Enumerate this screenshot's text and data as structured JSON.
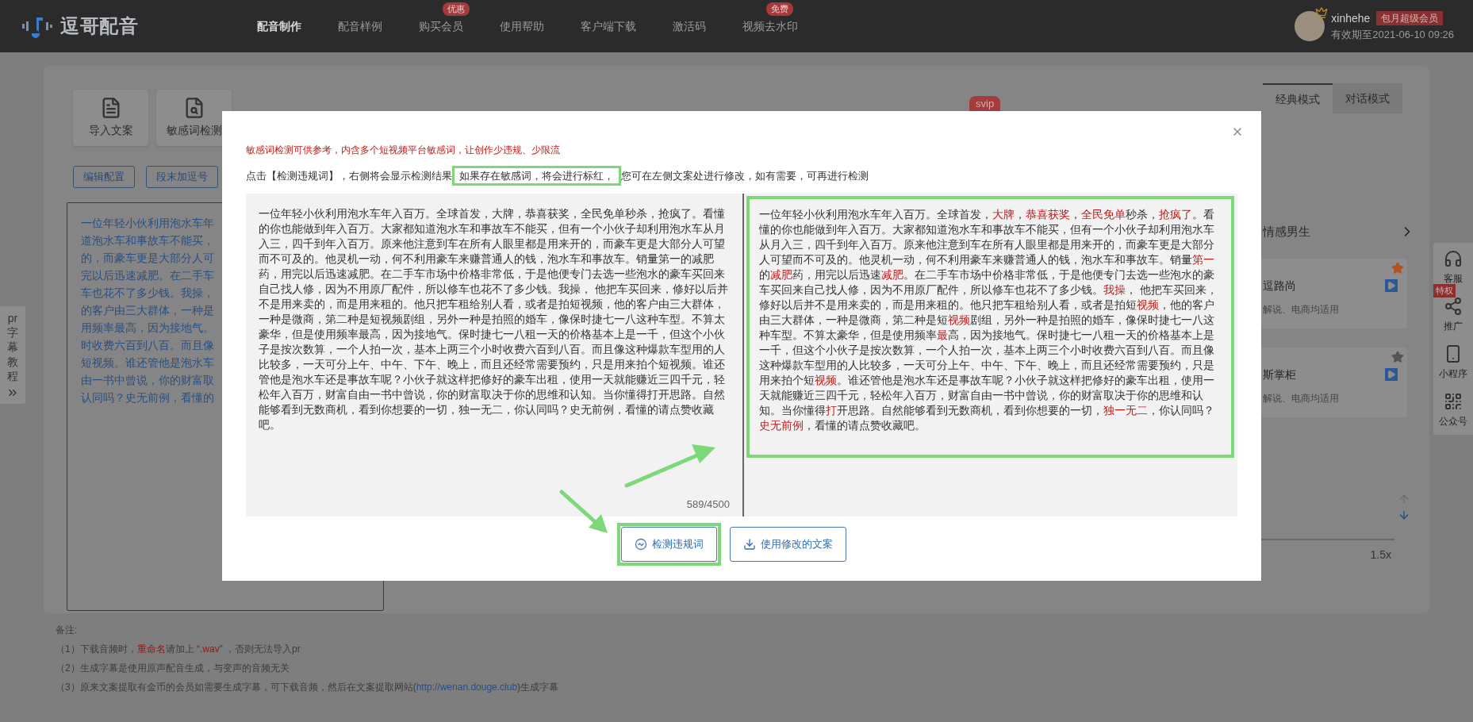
{
  "header": {
    "logo": "逗哥配音",
    "nav": [
      {
        "label": "配音制作",
        "selected": true
      },
      {
        "label": "配音样例",
        "selected": false
      },
      {
        "label": "购买会员",
        "selected": false,
        "badge": "优惠"
      },
      {
        "label": "使用帮助",
        "selected": false
      },
      {
        "label": "客户端下载",
        "selected": false
      },
      {
        "label": "激活码",
        "selected": false
      },
      {
        "label": "视频去水印",
        "selected": false,
        "badge": "免费"
      }
    ],
    "user": {
      "name": "xinhehe",
      "badge": "包月超级会员",
      "expiry": "有效期至2021-06-10 09:26"
    }
  },
  "toolbar": [
    {
      "label": "导入文案",
      "kind": "import"
    },
    {
      "label": "敏感词检测",
      "kind": "check"
    }
  ],
  "toolbar_badge": "svip",
  "mode_tabs": [
    {
      "label": "经典模式",
      "selected": true
    },
    {
      "label": "对话模式",
      "selected": false
    }
  ],
  "edit_buttons": [
    "编辑配置",
    "段末加逗号"
  ],
  "editor_lines": [
    "一位年轻小伙利用泡水车年",
    "道泡水车和事故车不能买，",
    "的，而豪车更是大部分人可",
    "完以后迅速减肥。在二手车",
    "车也花不了多少钱。我操，",
    "的客户由三大群体，一种是",
    "用频率最高，因为接地气。",
    "时收费六百到八百。而且像",
    "短视频。谁还管他是泡水车",
    "由一书中曾说，你的财富取",
    "认同吗？史无前例，看懂的"
  ],
  "side_tab": {
    "label": "pr字幕教程"
  },
  "voice_panel": {
    "category": "情感男生",
    "voices": [
      {
        "name": "逗路尚",
        "tags": "解说、电商均适用",
        "favorite": true
      },
      {
        "name": "斯掌柜",
        "tags": "解说、电商均适用",
        "favorite": false
      }
    ],
    "speed_label": "1.5x"
  },
  "float_bar": [
    {
      "label": "客服",
      "kind": "service"
    },
    {
      "label": "推广",
      "kind": "share",
      "badge": "特权"
    },
    {
      "label": "小程序",
      "kind": "mini"
    },
    {
      "label": "公众号",
      "kind": "qr"
    }
  ],
  "notes": {
    "title": "备注:",
    "items": [
      [
        {
          "text": "（1）下载音频时，",
          "kind": "plain"
        },
        {
          "text": "重命名",
          "kind": "red"
        },
        {
          "text": "请加上 ",
          "kind": "plain"
        },
        {
          "text": "“.wav”",
          "kind": "red"
        },
        {
          "text": " ，否则无法导入pr",
          "kind": "plain"
        }
      ],
      [
        {
          "text": "（2）生成字幕是使用原声配音生成，与变声的音频无关",
          "kind": "plain"
        }
      ],
      [
        {
          "text": "（3）原来文案提取有金币的会员如需要生成字幕，可下载音频，然后在文案提取网站(",
          "kind": "plain"
        },
        {
          "text": "http://wenan.douge.club",
          "kind": "link"
        },
        {
          "text": ")生成字幕",
          "kind": "plain"
        }
      ]
    ]
  },
  "dialog": {
    "warning": "敏感词检测可供参考，内含多个短视频平台敏感词，让创作少违规、少限流",
    "instruction": [
      {
        "text": "点击【检测违规词】，右侧将会显示检测结果",
        "highlighted": false
      },
      {
        "text": "如果存在敏感词，将会进行标红，",
        "highlighted": true
      },
      {
        "text": "您可在左侧文案处进行修改，如有需要，可再进行检测",
        "highlighted": false
      }
    ],
    "source_text": "一位年轻小伙利用泡水车年入百万。全球首发，大牌，恭喜获奖，全民免单秒杀，抢疯了。看懂的你也能做到年入百万。大家都知道泡水车和事故车不能买，但有一个小伙子却利用泡水车从月入三，四千到年入百万。原来他注意到车在所有人眼里都是用来开的，而豪车更是大部分人可望而不可及的。他灵机一动，何不利用豪车来赚普通人的钱，泡水车和事故车。销量第一的减肥药，用完以后迅速减肥。在二手车市场中价格非常低，于是他便专门去选一些泡水的豪车买回来自己找人修，因为不用原厂配件，所以修车也花不了多少钱。我操， 他把车买回来，修好以后并不是用来卖的，而是用来租的。他只把车租给别人看，或者是拍短视频，他的客户由三大群体，一种是微商，第二种是短视频剧组，另外一种是拍照的婚车，像保时捷七一八这种车型。不算太豪华，但是使用频率最高，因为接地气。保时捷七一八租一天的价格基本上是一千，但这个小伙子是按次数算，一个人拍一次，基本上两三个小时收费六百到八百。而且像这种爆款车型用的人比较多，一天可分上午、中午、下午、晚上，而且还经常需要预约，只是用来拍个短视频。谁还管他是泡水车还是事故车呢？小伙子就这样把修好的豪车出租，使用一天就能赚近三四千元，轻松年入百万，财富自由一书中曾说，你的财富取决于你的思维和认知。当你懂得打开思路。自然能够看到无数商机，看到你想要的一切，独一无二，你认同吗？史无前例，看懂的请点赞收藏吧。",
    "counter": "589/4500",
    "result_highlighted": true,
    "result": [
      {
        "text": "一位年轻小伙利用泡水车年入百万。全球首发，",
        "flagged": false
      },
      {
        "text": "大牌",
        "flagged": true
      },
      {
        "text": "，",
        "flagged": false
      },
      {
        "text": "恭喜获奖",
        "flagged": true
      },
      {
        "text": "，",
        "flagged": false
      },
      {
        "text": "全民免单",
        "flagged": true
      },
      {
        "text": "秒杀，",
        "flagged": false
      },
      {
        "text": "抢疯了",
        "flagged": true
      },
      {
        "text": "。看懂的你也能做到年入百万。大家都知道泡水车和事故车不能买，但有一个小伙子却利用泡水车从月入三，四千到年入百万。原来他注意到车在所有人眼里都是用来开的，而豪车更是大部分人可望而不可及的。他灵机一动，何不利用豪车来赚普通人的钱，泡水车和事故车。销量",
        "flagged": false
      },
      {
        "text": "第一",
        "flagged": true
      },
      {
        "text": "的",
        "flagged": false
      },
      {
        "text": "减肥",
        "flagged": true
      },
      {
        "text": "药，用完以后迅速",
        "flagged": false
      },
      {
        "text": "减肥",
        "flagged": true
      },
      {
        "text": "。在二手车市场中价格非常低，于是他便专门去选一些泡水的豪车买回来自己找人修，因为不用原厂配件，所以修车也花不了多少钱。",
        "flagged": false
      },
      {
        "text": "我操",
        "flagged": true
      },
      {
        "text": "， 他把车买回来，修好以后并不是用来卖的，而是用来租的。他只把车租给别人看，或者是拍短",
        "flagged": false
      },
      {
        "text": "视频",
        "flagged": true
      },
      {
        "text": "，他的客户由三大群体，一种是微商，第二种是短",
        "flagged": false
      },
      {
        "text": "视频",
        "flagged": true
      },
      {
        "text": "剧组，另外一种是拍照的婚车，像保时捷七一八这种车型。不算太豪华，但是使用频率",
        "flagged": false
      },
      {
        "text": "最",
        "flagged": true
      },
      {
        "text": "高，因为接地气。保时捷七一八租一天的价格基本上是一千，但这个小伙子是按次数算，一个人拍一次，基本上两三个小时收费六百到八百。而且像这种爆款车型用的人比较多，一天可分上午、中午、下午、晚上，而且还经常需要预约，只是用来拍个短",
        "flagged": false
      },
      {
        "text": "视频",
        "flagged": true
      },
      {
        "text": "。谁还管他是泡水车还是事故车呢？小伙子就这样把修好的豪车出租，使用一天就能赚近三四千元，轻松年入百万，财富自由一书中曾说，你的财富取决于你的思维和认知。当你懂得",
        "flagged": false
      },
      {
        "text": "打",
        "flagged": true
      },
      {
        "text": "开思路。自然能够看到无数商机，看到你想要的一切，",
        "flagged": false
      },
      {
        "text": "独一无二",
        "flagged": true
      },
      {
        "text": "，你认同吗？",
        "flagged": false
      },
      {
        "text": "史无前例",
        "flagged": true
      },
      {
        "text": "，看懂的请点赞收藏吧。",
        "flagged": false
      }
    ],
    "buttons": [
      {
        "label": "检测违规词",
        "kind": "check",
        "highlighted": true
      },
      {
        "label": "使用修改的文案",
        "kind": "download",
        "highlighted": false
      }
    ]
  }
}
